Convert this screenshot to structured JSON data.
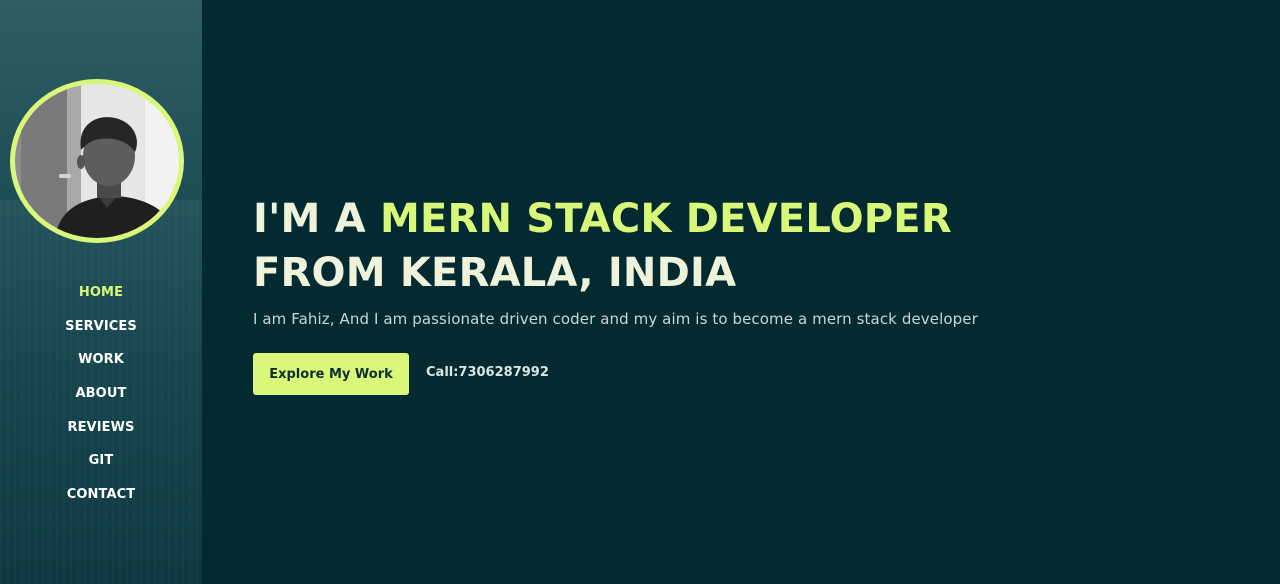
{
  "sidebar": {
    "avatar_alt": "Profile photo",
    "nav": [
      {
        "label": "HOME",
        "active": true
      },
      {
        "label": "SERVICES",
        "active": false
      },
      {
        "label": "WORK",
        "active": false
      },
      {
        "label": "ABOUT",
        "active": false
      },
      {
        "label": "REVIEWS",
        "active": false
      },
      {
        "label": "GIT",
        "active": false
      },
      {
        "label": "CONTACT",
        "active": false
      }
    ]
  },
  "hero": {
    "headline_prefix": "I'M A ",
    "headline_accent": "MERN STACK DEVELOPER",
    "headline_line2": "FROM KERALA, INDIA",
    "tagline": "I am Fahiz, And I am passionate driven coder and my aim is to become a mern stack developer",
    "cta_label": "Explore My Work",
    "phone_text": "Call:7306287992"
  },
  "colors": {
    "background": "#022a30",
    "sidebar": "#1d4d55",
    "accent": "#d9f87a",
    "heading": "#eff3dc",
    "body_text": "#c9d6d3"
  }
}
